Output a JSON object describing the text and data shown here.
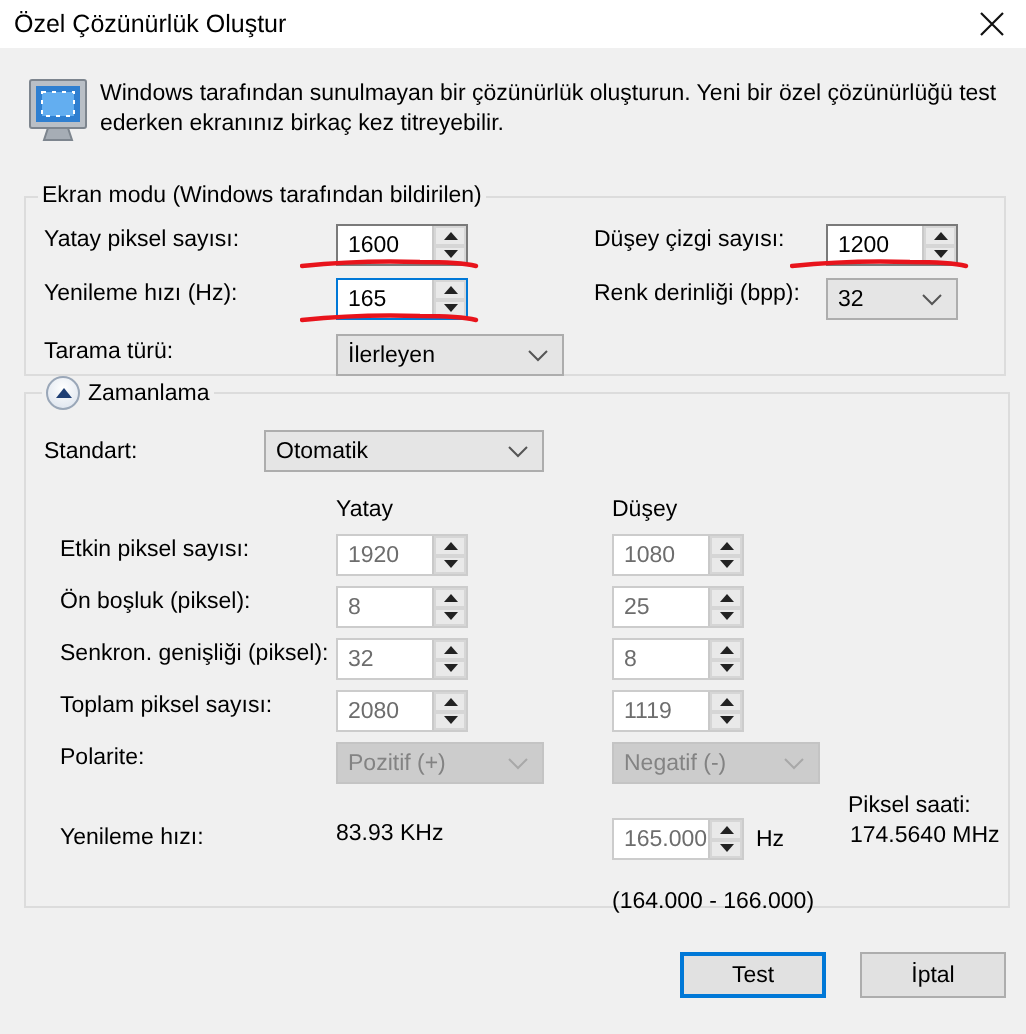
{
  "window": {
    "title": "Özel Çözünürlük Oluştur"
  },
  "intro": "Windows tarafından sunulmayan bir çözünürlük oluşturun. Yeni bir özel çözünürlüğü test ederken ekranınız birkaç kez titreyebilir.",
  "display_mode": {
    "legend": "Ekran modu (Windows tarafından bildirilen)",
    "fields": [
      {
        "kind": "spinner",
        "label": "Yatay piksel sayısı:",
        "value": "1600",
        "focused": false,
        "marked": true
      },
      {
        "kind": "spinner",
        "label": "Düşey çizgi sayısı:",
        "value": "1200",
        "focused": false,
        "marked": true
      },
      {
        "kind": "spinner",
        "label": "Yenileme hızı (Hz):",
        "value": "165",
        "focused": true,
        "marked": true
      },
      {
        "kind": "dropdown",
        "label": "Renk derinliği (bpp):",
        "value": "32",
        "disabled": false
      },
      {
        "kind": "dropdown",
        "label": "Tarama türü:",
        "value": "İlerleyen",
        "disabled": false
      }
    ]
  },
  "timing": {
    "title": "Zamanlama",
    "expanded": true,
    "standard": {
      "label": "Standart:",
      "value": "Otomatik"
    },
    "column_headers": [
      "Yatay",
      "Düşey"
    ],
    "rows": [
      {
        "label": "Etkin piksel sayısı:",
        "horizontal": "1920",
        "vertical": "1080",
        "disabled": true
      },
      {
        "label": "Ön boşluk (piksel):",
        "horizontal": "8",
        "vertical": "25",
        "disabled": true
      },
      {
        "label": "Senkron. genişliği (piksel):",
        "horizontal": "32",
        "vertical": "8",
        "disabled": true
      },
      {
        "label": "Toplam piksel sayısı:",
        "horizontal": "2080",
        "vertical": "1119",
        "disabled": true
      }
    ],
    "polarity": {
      "label": "Polarite:",
      "horizontal": "Pozitif (+)",
      "vertical": "Negatif (-)",
      "disabled": true
    },
    "refresh": {
      "label": "Yenileme hızı:",
      "horizontal": "83.93 KHz",
      "vertical": "165.000",
      "disabled": true,
      "unit": "Hz",
      "range": "(164.000 - 166.000)"
    },
    "pixel_clock": {
      "label": "Piksel saati:",
      "value": "174.5640 MHz"
    }
  },
  "buttons": [
    {
      "label": "Test",
      "default": true
    },
    {
      "label": "İptal",
      "default": false
    }
  ]
}
